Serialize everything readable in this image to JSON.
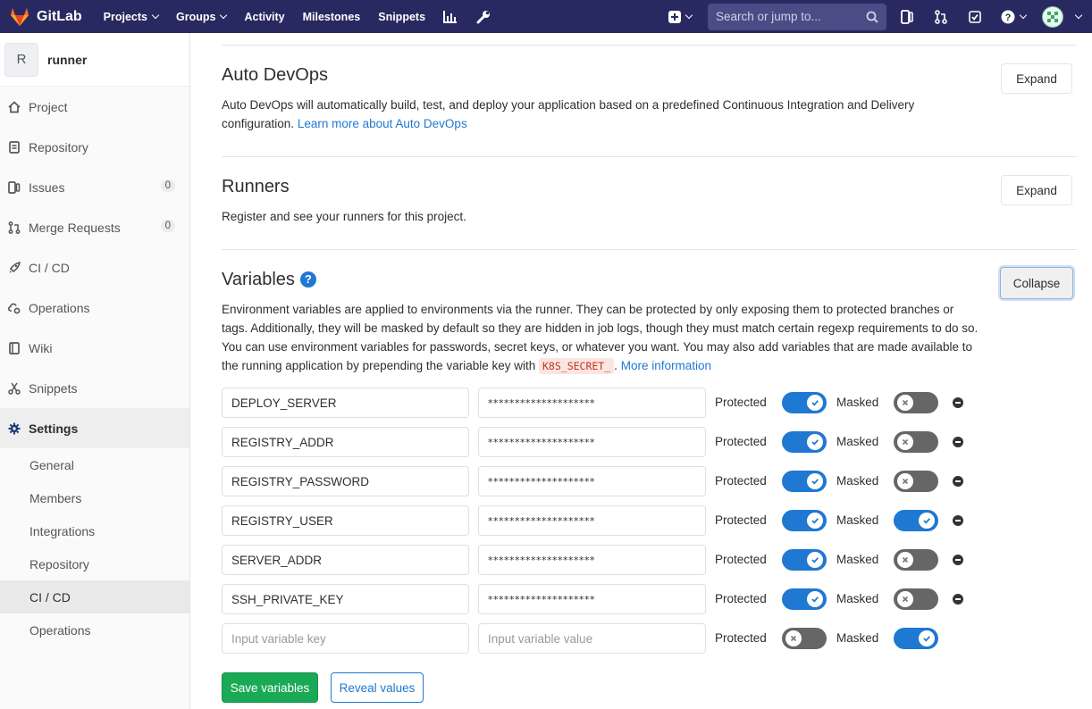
{
  "topbar": {
    "brand": "GitLab",
    "nav": [
      {
        "label": "Projects",
        "caret": true
      },
      {
        "label": "Groups",
        "caret": true
      },
      {
        "label": "Activity",
        "caret": false
      },
      {
        "label": "Milestones",
        "caret": false
      },
      {
        "label": "Snippets",
        "caret": false
      }
    ],
    "search_placeholder": "Search or jump to...",
    "icons": [
      "chart-icon",
      "wrench-icon",
      "plus-icon",
      "issues-icon",
      "merge-request-icon",
      "todo-icon",
      "help-icon",
      "avatar"
    ]
  },
  "sidebar": {
    "project_initial": "R",
    "project_name": "runner",
    "items": [
      {
        "label": "Project",
        "icon": "home-icon"
      },
      {
        "label": "Repository",
        "icon": "document-icon"
      },
      {
        "label": "Issues",
        "icon": "issues-icon",
        "count": "0"
      },
      {
        "label": "Merge Requests",
        "icon": "merge-request-icon",
        "count": "0"
      },
      {
        "label": "CI / CD",
        "icon": "rocket-icon"
      },
      {
        "label": "Operations",
        "icon": "cloud-gear-icon"
      },
      {
        "label": "Wiki",
        "icon": "book-icon"
      },
      {
        "label": "Snippets",
        "icon": "scissors-icon"
      },
      {
        "label": "Settings",
        "icon": "gear-icon"
      }
    ],
    "settings_sub": [
      "General",
      "Members",
      "Integrations",
      "Repository",
      "CI / CD",
      "Operations"
    ],
    "active_sub": "CI / CD"
  },
  "auto_devops": {
    "title": "Auto DevOps",
    "desc": "Auto DevOps will automatically build, test, and deploy your application based on a predefined Continuous Integration and Delivery configuration.",
    "link": "Learn more about Auto DevOps",
    "button": "Expand"
  },
  "runners": {
    "title": "Runners",
    "desc": "Register and see your runners for this project.",
    "button": "Expand"
  },
  "variables": {
    "title": "Variables",
    "button": "Collapse",
    "desc_part1": "Environment variables are applied to environments via the runner. They can be protected by only exposing them to protected branches or tags. Additionally, they will be masked by default so they are hidden in job logs, though they must match certain regexp requirements to do so. You can use environment variables for passwords, secret keys, or whatever you want. You may also add variables that are made available to the running application by prepending the variable key with",
    "code": "K8S_SECRET_",
    "desc_part2": ".",
    "link": "More information",
    "protected_label": "Protected",
    "masked_label": "Masked",
    "rows": [
      {
        "key": "DEPLOY_SERVER",
        "value": "********************",
        "protected": true,
        "masked": false
      },
      {
        "key": "REGISTRY_ADDR",
        "value": "********************",
        "protected": true,
        "masked": false
      },
      {
        "key": "REGISTRY_PASSWORD",
        "value": "********************",
        "protected": true,
        "masked": false
      },
      {
        "key": "REGISTRY_USER",
        "value": "********************",
        "protected": true,
        "masked": true
      },
      {
        "key": "SERVER_ADDR",
        "value": "********************",
        "protected": true,
        "masked": false
      },
      {
        "key": "SSH_PRIVATE_KEY",
        "value": "********************",
        "protected": true,
        "masked": false
      }
    ],
    "new_row": {
      "key_placeholder": "Input variable key",
      "value_placeholder": "Input variable value",
      "protected": false,
      "masked": true
    },
    "save_button": "Save variables",
    "reveal_button": "Reveal values"
  },
  "colors": {
    "topbar": "#292961",
    "link": "#1f78d1",
    "save": "#1aaa55",
    "toggle_on": "#1f78d1",
    "toggle_off": "#666666"
  }
}
